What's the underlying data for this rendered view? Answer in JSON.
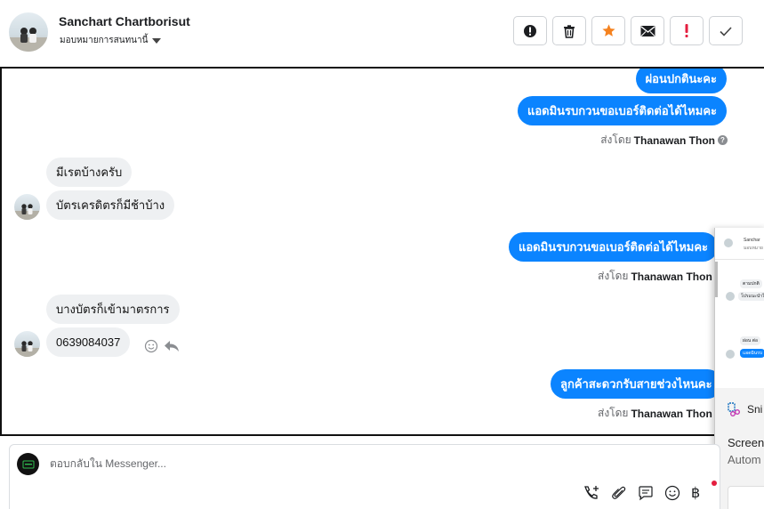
{
  "header": {
    "contact_name": "Sanchart Chartborisut",
    "assign_label": "มอบหมายการสนทนานี้",
    "toolbar": [
      {
        "name": "mark-spam-button",
        "icon": "exclamation-circle-icon"
      },
      {
        "name": "delete-button",
        "icon": "trash-icon"
      },
      {
        "name": "star-button",
        "icon": "star-icon",
        "color": "#f5821f"
      },
      {
        "name": "mark-unread-button",
        "icon": "envelope-icon"
      },
      {
        "name": "follow-up-button",
        "icon": "exclamation-icon",
        "color": "#e41e3f"
      },
      {
        "name": "mark-done-button",
        "icon": "check-icon"
      }
    ]
  },
  "conversation": {
    "outgoing_1": "ผ่อนปกตินะคะ",
    "outgoing_2": "แอดมินรบกวนขอเบอร์ติดต่อได้ไหมคะ",
    "sent_by_1": {
      "prefix": "ส่งโดย",
      "name": "Thanawan Thon"
    },
    "incoming_1": "มีเรตบ้างครับ",
    "incoming_2": "บัตรเครดิตรก็มีช้าบ้าง",
    "outgoing_3": "แอดมินรบกวนขอเบอร์ติดต่อได้ไหมคะ",
    "sent_by_2": {
      "prefix": "ส่งโดย",
      "name": "Thanawan Thon"
    },
    "incoming_3": "บางบัตรก็เข้ามาตรการ",
    "incoming_4": "0639084037",
    "outgoing_4": "ลูกค้าสะดวกรับสายช่วงไหนคะ",
    "sent_by_3": {
      "prefix": "ส่งโดย",
      "name": "Thanawan Thon"
    }
  },
  "overlay": {
    "mini_name": "Sanchar",
    "mini_sub": "มอบหมาย",
    "snip_label": "Sni",
    "line1": "Screen",
    "line2": "Autom"
  },
  "composer": {
    "placeholder": "ตอบกลับใน Messenger...",
    "icons": [
      "phone-plus-icon",
      "paperclip-icon",
      "saved-reply-icon",
      "emoji-icon",
      "baht-icon"
    ]
  },
  "colors": {
    "outgoing_bubble": "#0b84ff",
    "incoming_bubble": "#eef0f2",
    "star": "#f5821f",
    "alert": "#e41e3f"
  }
}
